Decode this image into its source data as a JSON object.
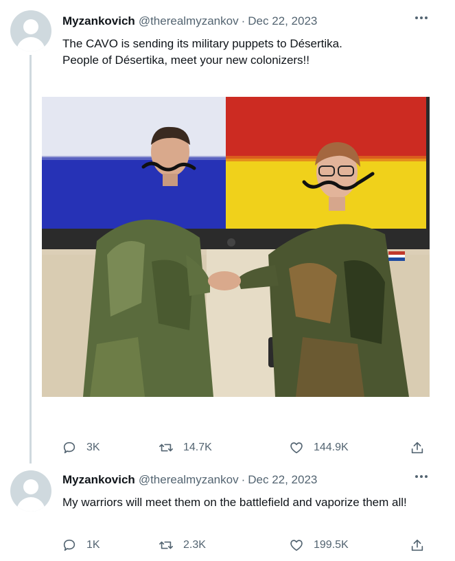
{
  "tweets": [
    {
      "author_name": "Myzankovich",
      "handle": "@therealmyzankov",
      "separator": "·",
      "date": "Dec 22, 2023",
      "text": "The CAVO is sending its military puppets to Désertika.\nPeople of Désertika, meet your new colonizers!!",
      "media": {
        "description_icon": "photo",
        "flag_left_colors": [
          "#e6e9f4",
          "#2431b8"
        ],
        "flag_right_colors": [
          "#cf2c24",
          "#f0d21a"
        ]
      },
      "actions": {
        "replies": "3K",
        "retweets": "14.7K",
        "likes": "144.9K"
      }
    },
    {
      "author_name": "Myzankovich",
      "handle": "@therealmyzankov",
      "separator": "·",
      "date": "Dec 22, 2023",
      "text": "My warriors will meet them on the battlefield and vaporize them all!",
      "actions": {
        "replies": "1K",
        "retweets": "2.3K",
        "likes": "199.5K"
      }
    }
  ],
  "icons": {
    "reply": "speech-bubble-icon",
    "retweet": "retweet-arrows-icon",
    "like": "heart-icon",
    "share": "share-upload-icon",
    "more": "more-dots-icon",
    "avatar": "default-avatar-icon"
  },
  "colors": {
    "text_primary": "#0f1419",
    "text_secondary": "#536471",
    "thread_line": "#cfd9de",
    "avatar_bg": "#cfd9de"
  }
}
